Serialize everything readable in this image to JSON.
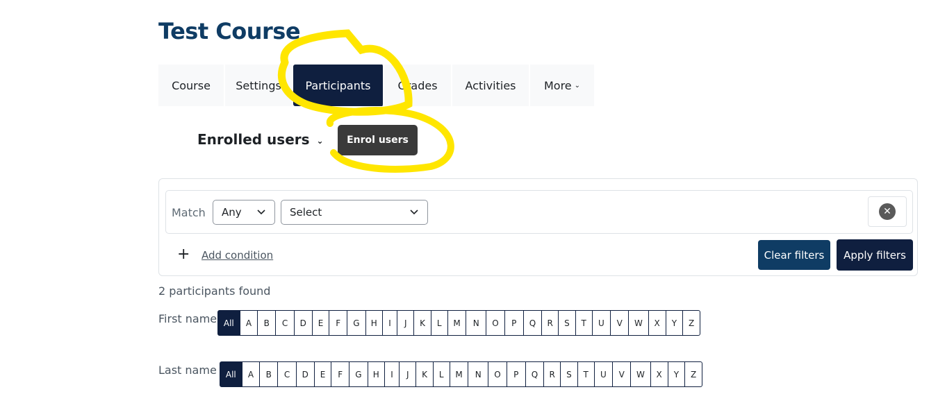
{
  "course": {
    "title": "Test Course"
  },
  "tabs": [
    {
      "label": "Course"
    },
    {
      "label": "Settings"
    },
    {
      "label": "Participants",
      "active": true
    },
    {
      "label": "Grades"
    },
    {
      "label": "Activities"
    },
    {
      "label": "More"
    }
  ],
  "enrolled": {
    "title": "Enrolled users",
    "chevron_icon": "chevron-down-icon"
  },
  "enrol_button": {
    "label": "Enrol users"
  },
  "filter": {
    "match_label": "Match",
    "match_value": "Any",
    "condition_value": "Select",
    "remove_icon": "close-circle-icon",
    "add_icon": "plus-icon",
    "add_condition": "Add condition",
    "clear_label": "Clear filters",
    "apply_label": "Apply filters"
  },
  "participants_count": "2 participants found",
  "initials": {
    "first_label": "First name",
    "last_label": "Last name",
    "all_label": "All",
    "letters": [
      "A",
      "B",
      "C",
      "D",
      "E",
      "F",
      "G",
      "H",
      "I",
      "J",
      "K",
      "L",
      "M",
      "N",
      "O",
      "P",
      "Q",
      "R",
      "S",
      "T",
      "U",
      "V",
      "W",
      "X",
      "Y",
      "Z"
    ]
  },
  "colors": {
    "primary_dark": "#0f1f3f",
    "primary": "#0f3c64",
    "highlight": "#ffe600",
    "enrol_btn": "#3a3a3a"
  }
}
